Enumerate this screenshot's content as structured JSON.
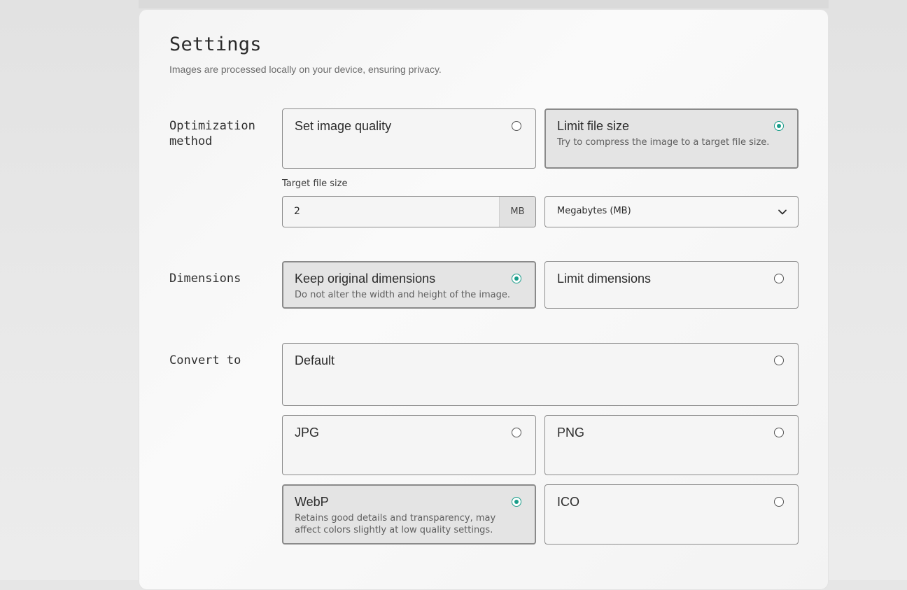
{
  "settings": {
    "title": "Settings",
    "subtitle": "Images are processed locally on your device, ensuring privacy."
  },
  "optimization": {
    "label": "Optimization\nmethod",
    "options": [
      {
        "title": "Set image quality",
        "desc": "",
        "selected": false
      },
      {
        "title": "Limit file size",
        "desc": "Try to compress the image to a target file size.",
        "selected": true
      }
    ],
    "target_label": "Target file size",
    "target_value": "2",
    "target_unit": "MB",
    "unit_select_value": "Megabytes (MB)"
  },
  "dimensions": {
    "label": "Dimensions",
    "options": [
      {
        "title": "Keep original dimensions",
        "desc": "Do not alter the width and height of the image.",
        "selected": true
      },
      {
        "title": "Limit dimensions",
        "desc": "",
        "selected": false
      }
    ]
  },
  "convert": {
    "label": "Convert to",
    "options": [
      {
        "title": "Default",
        "desc": "",
        "selected": false
      },
      {
        "title": "JPG",
        "desc": "",
        "selected": false
      },
      {
        "title": "PNG",
        "desc": "",
        "selected": false
      },
      {
        "title": "WebP",
        "desc": "Retains good details and transparency, may affect colors slightly at low quality settings.",
        "selected": true
      },
      {
        "title": "ICO",
        "desc": "",
        "selected": false
      }
    ]
  },
  "colors": {
    "accent": "#1a9d8a"
  },
  "icons": {
    "select_chevron": "chevron-down-icon"
  }
}
